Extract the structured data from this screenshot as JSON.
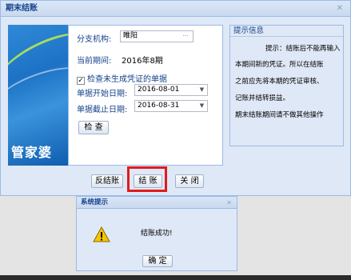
{
  "window": {
    "title": "期末结账",
    "close_glyph": "✕"
  },
  "brand": {
    "logo_text": "管家婆"
  },
  "form": {
    "branch_label": "分支机构:",
    "branch_value": "睢阳",
    "branch_button": "···",
    "period_label": "当前期间:",
    "period_value": "2016年8期",
    "check_label": "检查未生成凭证的单据",
    "check_state": "✓",
    "start_label": "单据开始日期:",
    "start_value": "2016-08-01",
    "end_label": "单据截止日期:",
    "end_value": "2016-08-31",
    "check_button": "检 查"
  },
  "hint": {
    "title": "提示信息",
    "lines": [
      "提示：结账后不能再输入",
      "本期间新的凭证。所以在结账",
      "之前应先将本期的凭证审核、",
      "记账并结转损益。",
      "期末结账期间请不做其他操作"
    ]
  },
  "actions": {
    "reverse": "反结账",
    "close_accounts": "结 账",
    "close": "关 闭"
  },
  "dialog": {
    "title": "系统提示",
    "close_glyph": "✕",
    "message": "结账成功!",
    "ok": "确 定"
  },
  "colors": {
    "highlight": "#e01b1b",
    "accent": "#15428b"
  }
}
